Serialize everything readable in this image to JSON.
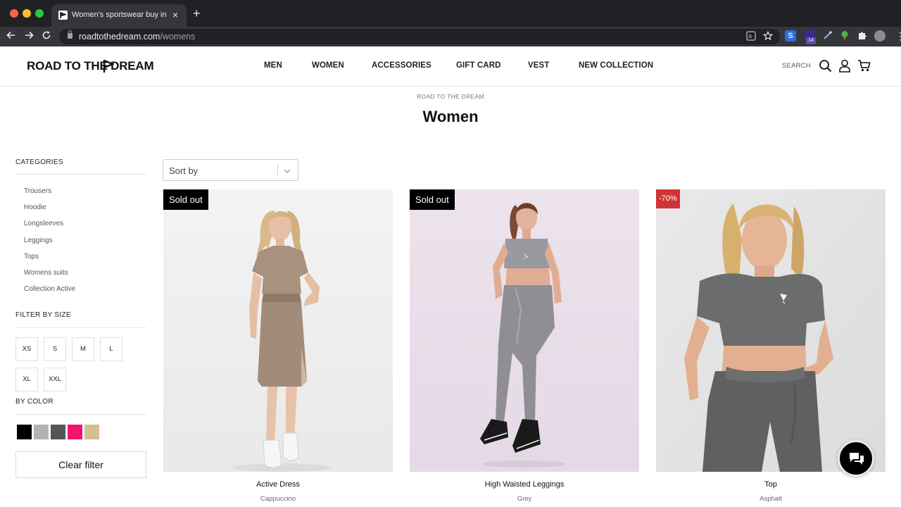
{
  "browser": {
    "tab_title": "Women's sportswear buy in Mo",
    "tab_close": "×",
    "new_tab": "+",
    "url_host": "roadtothedream.com",
    "url_path": "/womens",
    "extension_badge": "14",
    "extension_s": "S"
  },
  "site": {
    "logo_text": "ROAD TO THE DREAM",
    "nav": [
      "MEN",
      "WOMEN",
      "ACCESSORIES",
      "GIFT CARD",
      "VEST",
      "NEW COLLECTION"
    ],
    "search_label": "SEARCH"
  },
  "page": {
    "breadcrumb": "ROAD TO THE DREAM",
    "title": "Women"
  },
  "sidebar": {
    "categories_heading": "CATEGORIES",
    "categories": [
      "Trousers",
      "Hoodie",
      "Longsleeves",
      "Leggings",
      "Tops",
      "Womens suits",
      "Collection Active"
    ],
    "size_heading": "FILTER BY SIZE",
    "sizes": [
      "XS",
      "S",
      "M",
      "L",
      "XL",
      "XXL"
    ],
    "color_heading": "BY COLOR",
    "colors": [
      "#000000",
      "#b3b3b3",
      "#555555",
      "#f0146f",
      "#d2bf92"
    ],
    "clear_label": "Clear filter"
  },
  "sort": {
    "label": "Sort by"
  },
  "products": [
    {
      "name": "Active Dress",
      "color": "Cappuccino",
      "badge": "Sold out"
    },
    {
      "name": "High Waisted Leggings",
      "color": "Grey",
      "badge": "Sold out"
    },
    {
      "name": "Top",
      "color": "Asphalt",
      "badge": "-70%"
    }
  ]
}
